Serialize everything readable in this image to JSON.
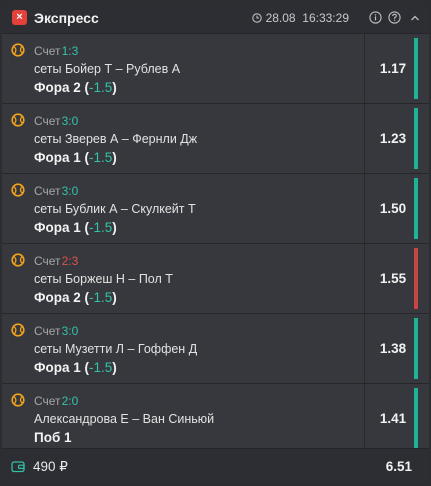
{
  "header": {
    "title": "Экспресс",
    "datetime": "28.08  16:33:29",
    "logo_symbol": "×"
  },
  "bets": [
    {
      "score_label": "Счет",
      "score": "1:3",
      "score_color": "#33c3a6",
      "match": "сеты Бойер Т – Рублев А",
      "market_name": "Фора 2 (",
      "handicap": "-1.5",
      "market_close": ")",
      "odds": "1.17",
      "stripe_color": "#1fb49a"
    },
    {
      "score_label": "Счет",
      "score": "3:0",
      "score_color": "#33c3a6",
      "match": "сеты Зверев А – Фернли Дж",
      "market_name": "Фора 1 (",
      "handicap": "-1.5",
      "market_close": ")",
      "odds": "1.23",
      "stripe_color": "#1fb49a"
    },
    {
      "score_label": "Счет",
      "score": "3:0",
      "score_color": "#33c3a6",
      "match": "сеты Бублик А – Скулкейт Т",
      "market_name": "Фора 1 (",
      "handicap": "-1.5",
      "market_close": ")",
      "odds": "1.50",
      "stripe_color": "#1fb49a"
    },
    {
      "score_label": "Счет",
      "score": "2:3",
      "score_color": "#e0524c",
      "match": "сеты Боржеш Н – Пол Т",
      "market_name": "Фора 2 (",
      "handicap": "-1.5",
      "market_close": ")",
      "odds": "1.55",
      "stripe_color": "#c9433f"
    },
    {
      "score_label": "Счет",
      "score": "3:0",
      "score_color": "#33c3a6",
      "match": "сеты Музетти Л – Гоффен Д",
      "market_name": "Фора 1 (",
      "handicap": "-1.5",
      "market_close": ")",
      "odds": "1.38",
      "stripe_color": "#1fb49a"
    },
    {
      "score_label": "Счет",
      "score": "2:0",
      "score_color": "#33c3a6",
      "match": "Александрова Е – Ван Синьюй",
      "market_name": "Поб 1",
      "handicap": "",
      "market_close": "",
      "odds": "1.41",
      "stripe_color": "#1fb49a"
    }
  ],
  "footer": {
    "stake": "490 ₽",
    "total_odds": "6.51"
  },
  "colors": {
    "accent": "#33c3a6",
    "loss": "#e0524c",
    "sport_icon": "#f2a31b",
    "logo": "#e3413a"
  },
  "icons": {
    "logo": "close-logo-icon",
    "clock": "clock-icon",
    "info": "info-icon",
    "help": "question-icon",
    "collapse": "chevron-up-icon",
    "sport": "tennis-ball-icon",
    "wallet": "wallet-icon"
  }
}
